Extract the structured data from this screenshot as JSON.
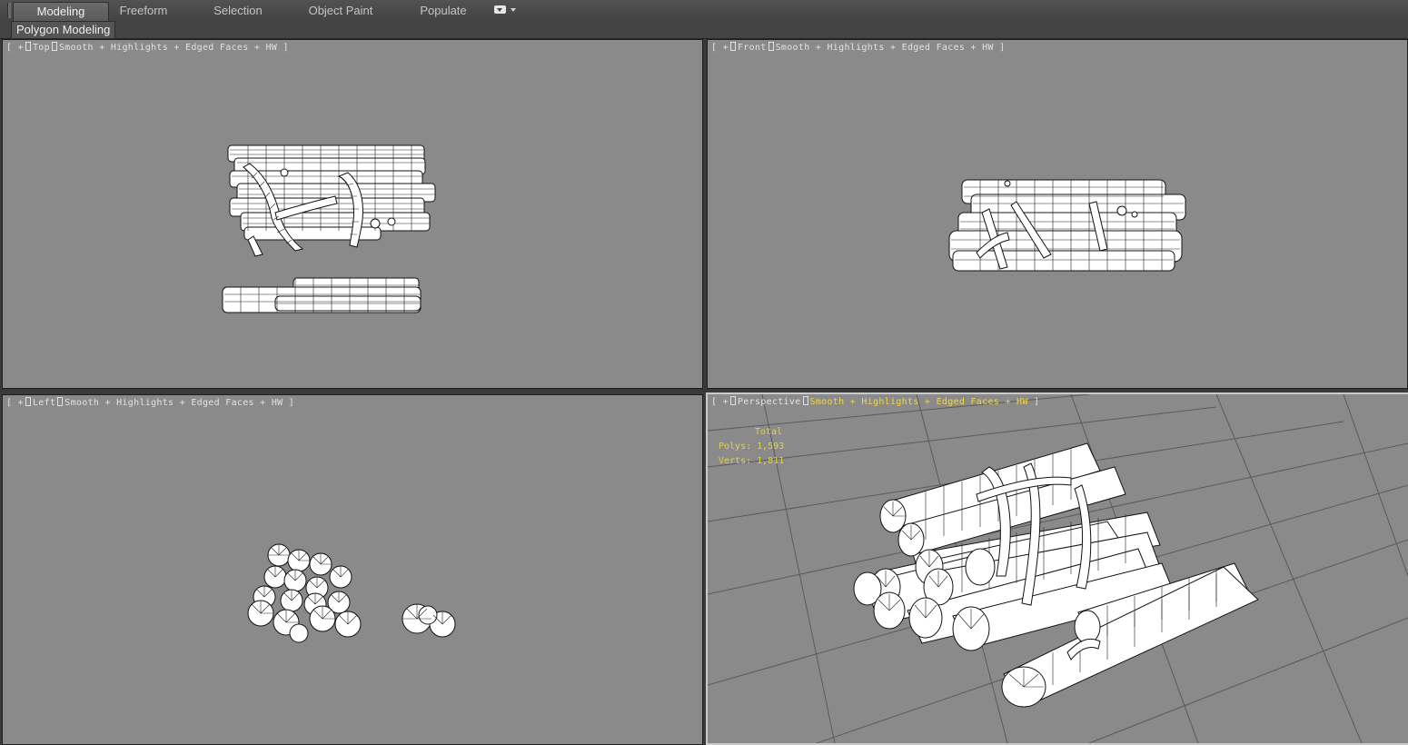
{
  "ribbon": {
    "tabs": [
      {
        "label": "Modeling",
        "active": true
      },
      {
        "label": "Freeform",
        "active": false
      },
      {
        "label": "Selection",
        "active": false
      },
      {
        "label": "Object Paint",
        "active": false
      },
      {
        "label": "Populate",
        "active": false
      }
    ],
    "options_icon": "dropdown-options-icon"
  },
  "subbar": {
    "label": "Polygon Modeling"
  },
  "viewports": {
    "top": {
      "plus": "+",
      "view": "Top",
      "shading": "Smooth + Highlights + Edged Faces + HW"
    },
    "front": {
      "plus": "+",
      "view": "Front",
      "shading": "Smooth + Highlights + Edged Faces + HW"
    },
    "left": {
      "plus": "+",
      "view": "Left",
      "shading": "Smooth + Highlights + Edged Faces + HW"
    },
    "perspective": {
      "plus": "+",
      "view": "Perspective",
      "shading": "Smooth + Highlights + Edged Faces + HW",
      "stats": {
        "total": "Total",
        "polys": "Polys:  1,593",
        "verts": "Verts:  1,811"
      }
    }
  },
  "colors": {
    "viewport_bg": "#8a8a8a",
    "active_label": "#f2d642",
    "stats_text": "#e8d23a",
    "ui_dark": "#444444"
  }
}
